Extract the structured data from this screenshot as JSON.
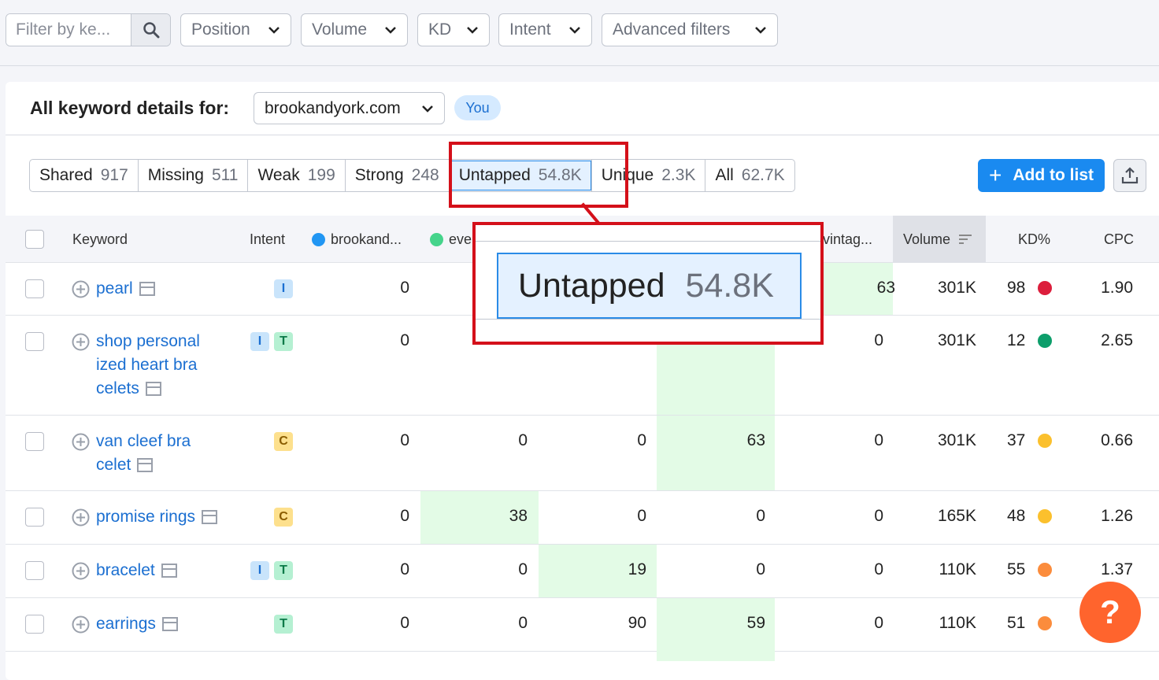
{
  "filters": {
    "search_placeholder": "Filter by ke...",
    "dropdowns": [
      "Position",
      "Volume",
      "KD",
      "Intent",
      "Advanced filters"
    ]
  },
  "panel": {
    "title": "All keyword details for:",
    "domain": "brookandyork.com",
    "you_badge": "You"
  },
  "tabs": [
    {
      "label": "Shared",
      "count": "917"
    },
    {
      "label": "Missing",
      "count": "511"
    },
    {
      "label": "Weak",
      "count": "199"
    },
    {
      "label": "Strong",
      "count": "248"
    },
    {
      "label": "Untapped",
      "count": "54.8K",
      "active": true
    },
    {
      "label": "Unique",
      "count": "2.3K"
    },
    {
      "label": "All",
      "count": "62.7K"
    }
  ],
  "actions": {
    "add_to_list": "Add to list"
  },
  "columns": {
    "keyword": "Keyword",
    "intent": "Intent",
    "comp1": "brookand...",
    "comp2": "eve",
    "comp5": "vintag...",
    "volume": "Volume",
    "kd": "KD%",
    "cpc": "CPC"
  },
  "colors": {
    "comp1": "#2196f3",
    "comp2": "#45d48b",
    "kd_hard": "#dc1e3c",
    "kd_easy": "#0d9e6b",
    "kd_medium": "#fbc02d",
    "kd_difficult": "#fb8c3c"
  },
  "rows": [
    {
      "keyword": "pearl",
      "lines": [
        "pearl"
      ],
      "intent": [
        "I"
      ],
      "c1": "0",
      "c2": "",
      "c3": "",
      "c4": "",
      "c5": "63",
      "volume": "301K",
      "kd": "98",
      "kd_color": "#dc1e3c",
      "cpc": "1.90"
    },
    {
      "keyword": "shop personalized heart bracelets",
      "lines": [
        "shop personal",
        "ized heart bra",
        "celets"
      ],
      "intent": [
        "I",
        "T"
      ],
      "c1": "0",
      "c2": "",
      "c3": "",
      "c4": "",
      "c5": "0",
      "volume": "301K",
      "kd": "12",
      "kd_color": "#0d9e6b",
      "cpc": "2.65"
    },
    {
      "keyword": "van cleef bracelet",
      "lines": [
        "van cleef bra",
        "celet"
      ],
      "intent": [
        "C"
      ],
      "c1": "0",
      "c2": "0",
      "c3": "0",
      "c4": "63",
      "c5": "0",
      "volume": "301K",
      "kd": "37",
      "kd_color": "#fbc02d",
      "cpc": "0.66"
    },
    {
      "keyword": "promise rings",
      "lines": [
        "promise rings"
      ],
      "intent": [
        "C"
      ],
      "c1": "0",
      "c2": "38",
      "c3": "0",
      "c4": "0",
      "c5": "0",
      "volume": "165K",
      "kd": "48",
      "kd_color": "#fbc02d",
      "cpc": "1.26"
    },
    {
      "keyword": "bracelet",
      "lines": [
        "bracelet"
      ],
      "intent": [
        "I",
        "T"
      ],
      "c1": "0",
      "c2": "0",
      "c3": "19",
      "c4": "0",
      "c5": "0",
      "volume": "110K",
      "kd": "55",
      "kd_color": "#fb8c3c",
      "cpc": "1.37"
    },
    {
      "keyword": "earrings",
      "lines": [
        "earrings"
      ],
      "intent": [
        "T"
      ],
      "c1": "0",
      "c2": "0",
      "c3": "90",
      "c4": "59",
      "c5": "0",
      "volume": "110K",
      "kd": "51",
      "kd_color": "#fb8c3c",
      "cpc": ""
    }
  ],
  "zoom": {
    "label": "Untapped",
    "count": "54.8K"
  },
  "help": "?"
}
